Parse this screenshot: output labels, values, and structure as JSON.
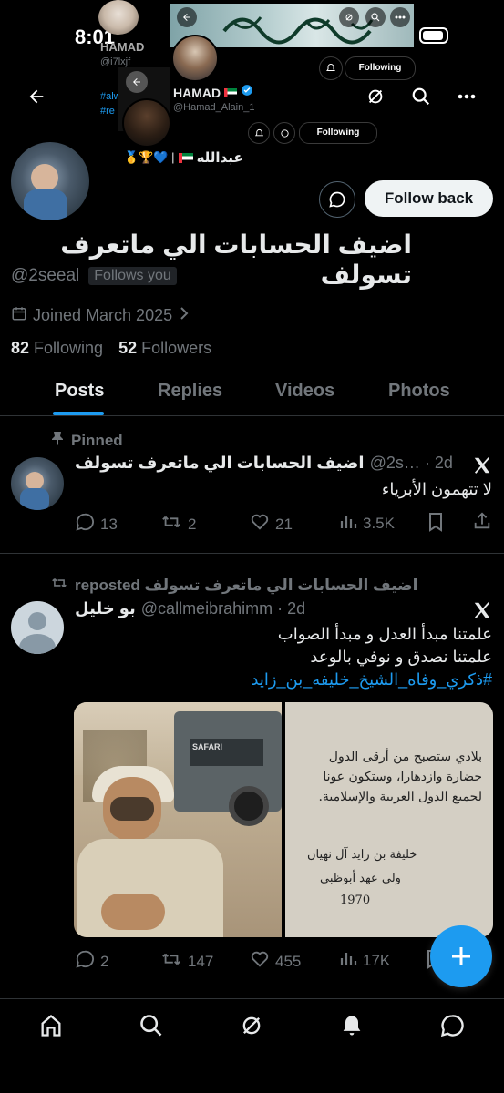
{
  "status_bar": {
    "time": "8:01"
  },
  "overlay": {
    "top_handle": "HAMAD",
    "top_following": "Following",
    "mid_name": "HAMAD",
    "mid_handle": "@Hamad_Alain_1",
    "mid_following": "Following",
    "small_handle": "@i7lxjf",
    "small_following": "Following",
    "left_tags": [
      "#alw",
      "#re"
    ],
    "abdullah_name": "عبدالله",
    "abdullah_emojis": "🥇🏆💙 |"
  },
  "profile": {
    "display_name": "اضيف الحسابات الي ماتعرف تسولف",
    "handle": "@2seeal",
    "follows_you": "Follows you",
    "joined": "Joined March 2025",
    "following_count": "82",
    "following_label": "Following",
    "followers_count": "52",
    "followers_label": "Followers",
    "follow_back": "Follow back"
  },
  "tabs": [
    "Posts",
    "Replies",
    "Videos",
    "Photos"
  ],
  "pinned_post": {
    "pinned_label": "Pinned",
    "author": "اضيف الحسابات الي ماتعرف تسولف",
    "handle_time": "@2s… · 2d",
    "text": "لا تتهمون الأبرياء",
    "replies": "13",
    "reposts": "2",
    "likes": "21",
    "views": "3.5K"
  },
  "repost": {
    "reposted_label": "اضيف الحسابات الي ماتعرف تسولف reposted",
    "author": "بو خليل",
    "handle_time": "@callmeibrahimm · 2d",
    "line1": "علمتنا مبدأ العدل و مبدأ الصواب",
    "line2": "علمتنا نصدق و نوفي بالوعد",
    "hashtag": "#ذكري_وفاه_الشيخ_خليفه_بن_زايد",
    "photo_left_caption": "SAFARI",
    "book_line1": "بلادي ستصبح من أرقى الدول",
    "book_line2": "حضارة وازدهارا، وستكون عونا",
    "book_line3": "لجميع الدول العربية والإسلامية.",
    "book_sign1": "خليفة بن زايد آل نهيان",
    "book_sign2": "ولي عهد أبوظبي",
    "book_year": "1970",
    "replies": "2",
    "reposts": "147",
    "likes": "455",
    "views": "17K"
  },
  "colors": {
    "accent": "#1d9bf0",
    "background": "#000000",
    "muted": "#71767b",
    "divider": "#2f3336"
  }
}
